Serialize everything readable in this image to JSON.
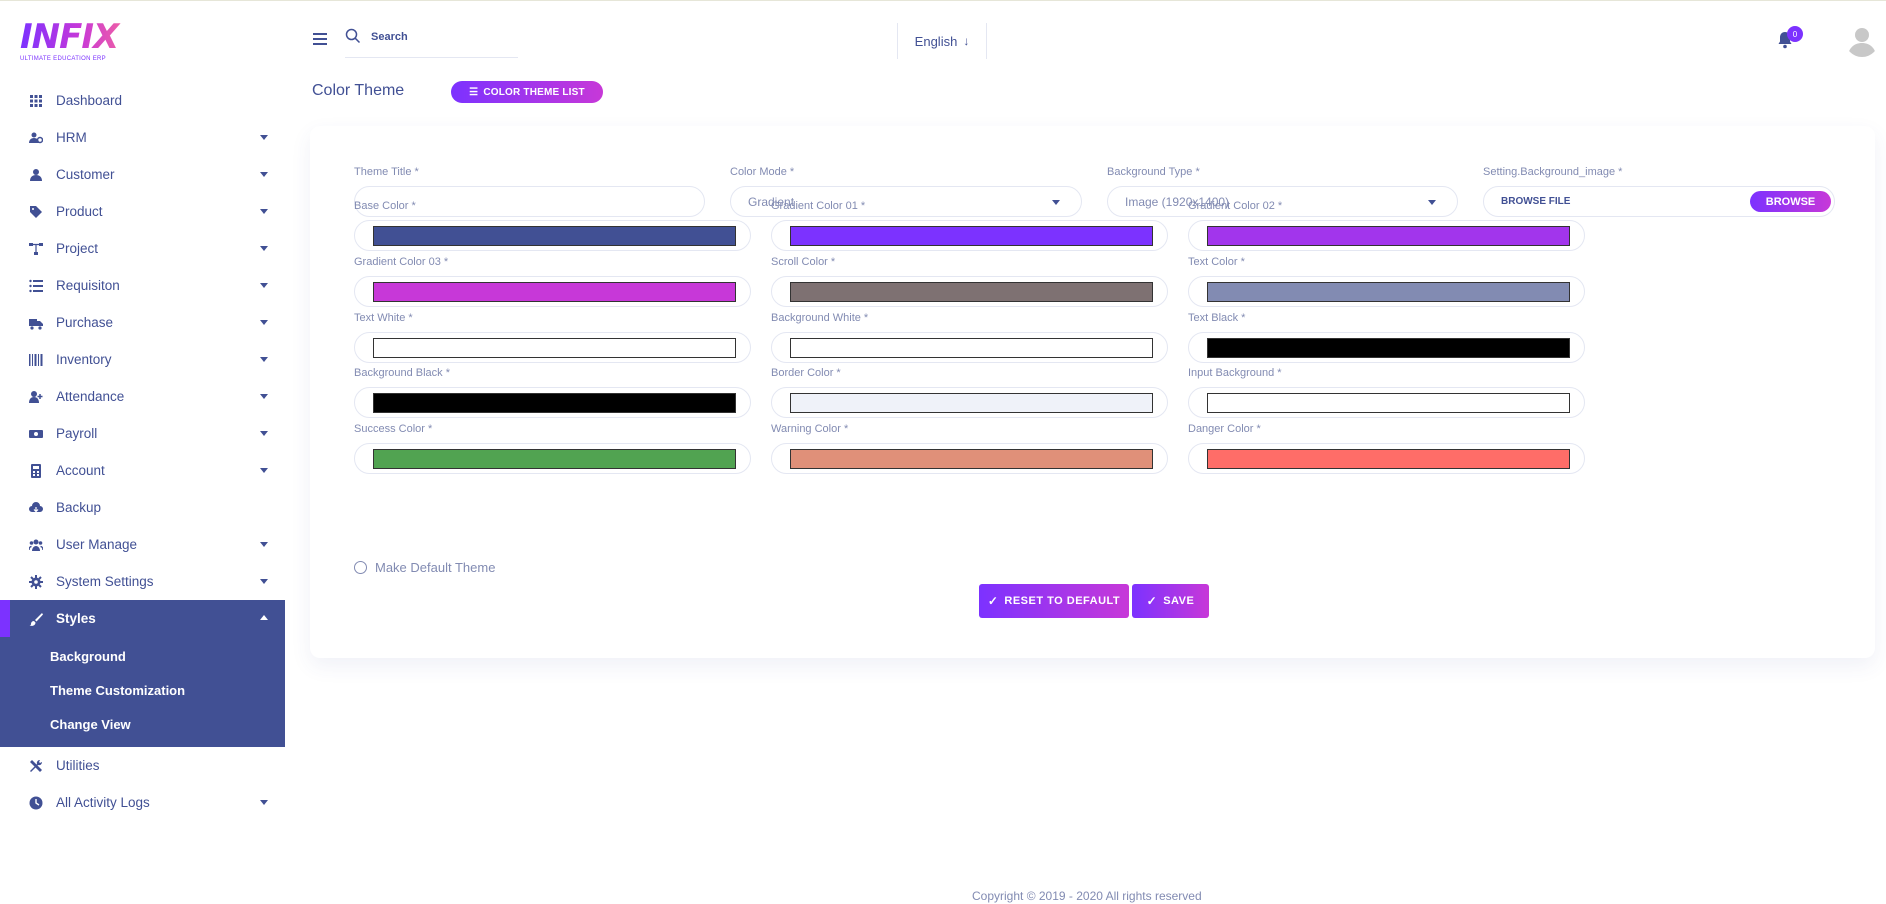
{
  "brand": {
    "logo_text": "INFIX",
    "logo_sub": "ULTIMATE EDUCATION ERP"
  },
  "header": {
    "search_placeholder": "Search",
    "language": "English",
    "notification_count": "0"
  },
  "sidebar": {
    "items": [
      {
        "label": "Dashboard",
        "icon": "grid-icon",
        "caret": false
      },
      {
        "label": "HRM",
        "icon": "users-cog-icon",
        "caret": true
      },
      {
        "label": "Customer",
        "icon": "user-icon",
        "caret": true
      },
      {
        "label": "Product",
        "icon": "tags-icon",
        "caret": true
      },
      {
        "label": "Project",
        "icon": "sitemap-icon",
        "caret": true
      },
      {
        "label": "Requisiton",
        "icon": "list-icon",
        "caret": true
      },
      {
        "label": "Purchase",
        "icon": "truck-icon",
        "caret": true
      },
      {
        "label": "Inventory",
        "icon": "barcode-icon",
        "caret": true
      },
      {
        "label": "Attendance",
        "icon": "user-plus-icon",
        "caret": true
      },
      {
        "label": "Payroll",
        "icon": "money-icon",
        "caret": true
      },
      {
        "label": "Account",
        "icon": "calculator-icon",
        "caret": true
      },
      {
        "label": "Backup",
        "icon": "cloud-download-icon",
        "caret": false
      },
      {
        "label": "User Manage",
        "icon": "users-icon",
        "caret": true
      },
      {
        "label": "System Settings",
        "icon": "gear-icon",
        "caret": true
      },
      {
        "label": "Styles",
        "icon": "brush-icon",
        "caret": true,
        "active": true
      }
    ],
    "styles_sub": [
      "Background",
      "Theme Customization",
      "Change View"
    ],
    "items_after": [
      {
        "label": "Utilities",
        "icon": "tools-icon",
        "caret": false
      },
      {
        "label": "All Activity Logs",
        "icon": "clock-icon",
        "caret": true
      }
    ]
  },
  "page": {
    "title": "Color Theme",
    "list_button": "COLOR THEME LIST"
  },
  "form": {
    "theme_title": {
      "label": "Theme Title *",
      "value": ""
    },
    "color_mode": {
      "label": "Color Mode *",
      "value": "Gradient"
    },
    "background_type": {
      "label": "Background Type *",
      "value": "Image (1920x1400)"
    },
    "background_image": {
      "label": "Setting.Background_image *",
      "placeholder": "BROWSE FILE",
      "button": "BROWSE"
    },
    "colors": [
      {
        "label": "Base Color *",
        "hex": "#415094"
      },
      {
        "label": "Gradient Color 01 *",
        "hex": "#7c32ff"
      },
      {
        "label": "Gradient Color 02 *",
        "hex": "#a235ec"
      },
      {
        "label": "Gradient Color 03 *",
        "hex": "#c738d8"
      },
      {
        "label": "Scroll Color *",
        "hex": "#7e7172"
      },
      {
        "label": "Text Color *",
        "hex": "#828bb2"
      },
      {
        "label": "Text White *",
        "hex": "#ffffff"
      },
      {
        "label": "Background White *",
        "hex": "#ffffff"
      },
      {
        "label": "Text Black *",
        "hex": "#000000"
      },
      {
        "label": "Background Black *",
        "hex": "#000000"
      },
      {
        "label": "Border Color *",
        "hex": "#eff2f9"
      },
      {
        "label": "Input Background *",
        "hex": "#ffffff"
      },
      {
        "label": "Success Color *",
        "hex": "#51a351"
      },
      {
        "label": "Warning Color *",
        "hex": "#e09079"
      },
      {
        "label": "Danger Color *",
        "hex": "#ff6d68"
      }
    ],
    "default_theme_label": "Make Default Theme",
    "reset_button": "RESET TO DEFAULT",
    "save_button": "SAVE"
  },
  "footer": {
    "text": "Copyright © 2019 - 2020 All rights reserved"
  },
  "accent": {
    "primary": "#7c32ff",
    "secondary": "#c738d8",
    "base": "#415094"
  }
}
